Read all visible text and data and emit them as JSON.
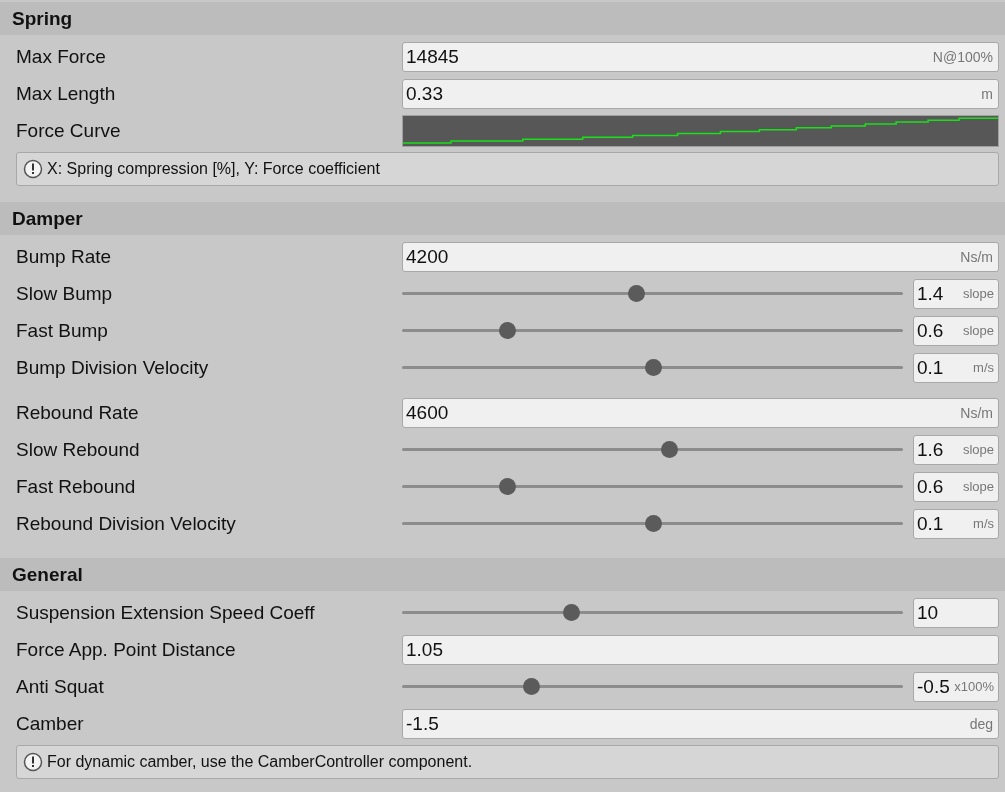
{
  "sections": [
    {
      "title": "Spring",
      "groups": [
        [
          {
            "kind": "field",
            "label": "Max Force",
            "value": "14845",
            "unit": "N@100%"
          },
          {
            "kind": "field",
            "label": "Max Length",
            "value": "0.33",
            "unit": "m"
          },
          {
            "kind": "curve",
            "label": "Force Curve"
          }
        ]
      ],
      "help": "X: Spring compression [%], Y: Force coefficient"
    },
    {
      "title": "Damper",
      "groups": [
        [
          {
            "kind": "field",
            "label": "Bump Rate",
            "value": "4200",
            "unit": "Ns/m"
          },
          {
            "kind": "slider",
            "label": "Slow Bump",
            "level": 0.467,
            "value": "1.4",
            "unit": "slope"
          },
          {
            "kind": "slider",
            "label": "Fast Bump",
            "level": 0.21,
            "value": "0.6",
            "unit": "slope"
          },
          {
            "kind": "slider",
            "label": "Bump Division Velocity",
            "level": 0.5,
            "value": "0.1",
            "unit": "m/s"
          }
        ],
        [
          {
            "kind": "field",
            "label": "Rebound Rate",
            "value": "4600",
            "unit": "Ns/m"
          },
          {
            "kind": "slider",
            "label": "Slow Rebound",
            "level": 0.532,
            "value": "1.6",
            "unit": "slope"
          },
          {
            "kind": "slider",
            "label": "Fast Rebound",
            "level": 0.21,
            "value": "0.6",
            "unit": "slope"
          },
          {
            "kind": "slider",
            "label": "Rebound Division Velocity",
            "level": 0.5,
            "value": "0.1",
            "unit": "m/s"
          }
        ]
      ]
    },
    {
      "title": "General",
      "groups": [
        [
          {
            "kind": "slider",
            "label": "Suspension Extension Speed Coeff",
            "level": 0.337,
            "value": "10"
          },
          {
            "kind": "field",
            "label": "Force App. Point Distance",
            "value": "1.05"
          },
          {
            "kind": "slider",
            "label": "Anti Squat",
            "level": 0.257,
            "value": "-0.5",
            "unit": "x100%"
          },
          {
            "kind": "field",
            "label": "Camber",
            "value": "-1.5",
            "unit": "deg"
          }
        ]
      ],
      "help": "For dynamic camber, use the CamberController component."
    }
  ]
}
